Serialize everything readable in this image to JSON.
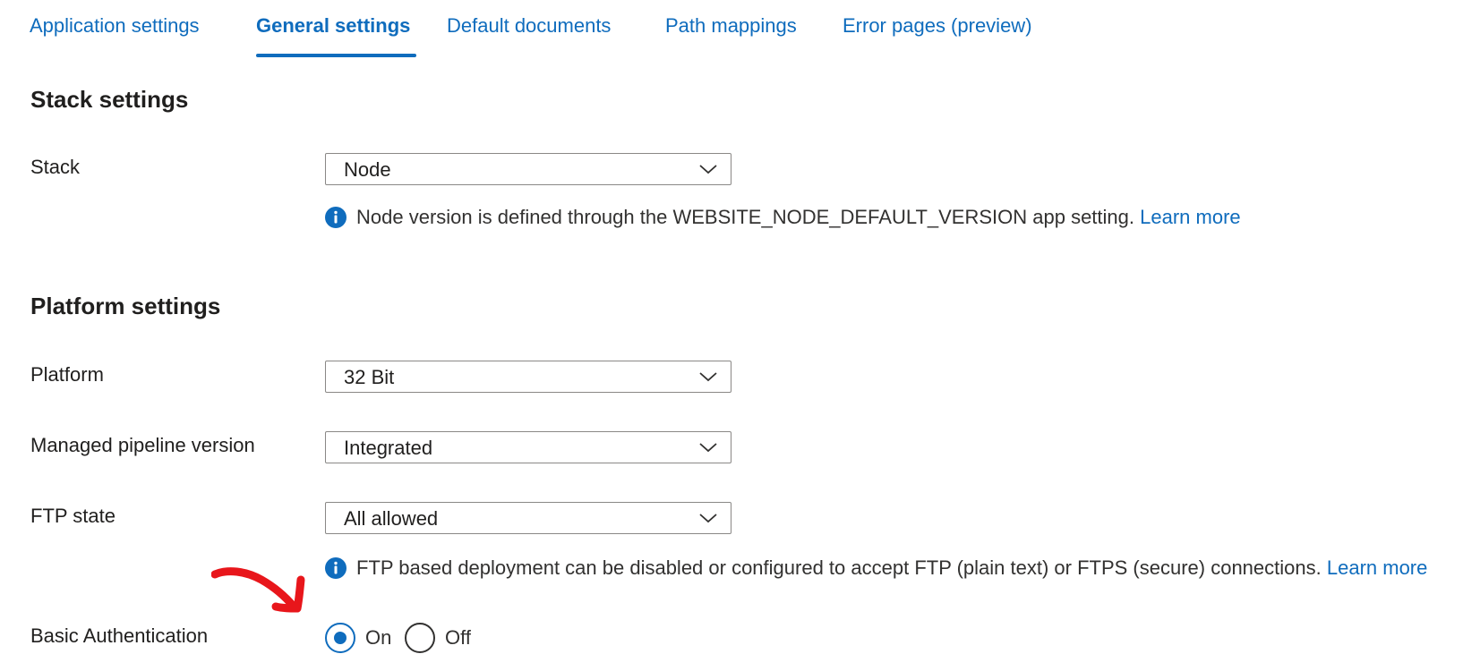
{
  "tabs": [
    {
      "label": "Application settings",
      "active": false
    },
    {
      "label": "General settings",
      "active": true
    },
    {
      "label": "Default documents",
      "active": false
    },
    {
      "label": "Path mappings",
      "active": false
    },
    {
      "label": "Error pages (preview)",
      "active": false
    }
  ],
  "stack_section": {
    "title": "Stack settings",
    "stack": {
      "label": "Stack",
      "value": "Node"
    },
    "info": {
      "text": "Node version is defined through the WEBSITE_NODE_DEFAULT_VERSION app setting.",
      "link": "Learn more"
    }
  },
  "platform_section": {
    "title": "Platform settings",
    "platform": {
      "label": "Platform",
      "value": "32 Bit"
    },
    "pipeline": {
      "label": "Managed pipeline version",
      "value": "Integrated"
    },
    "ftp": {
      "label": "FTP state",
      "value": "All allowed"
    },
    "ftp_info": {
      "text": "FTP based deployment can be disabled or configured to accept FTP (plain text) or FTPS (secure) connections.",
      "link": "Learn more"
    },
    "basic_auth": {
      "label": "Basic Authentication",
      "options": [
        "On",
        "Off"
      ],
      "selected": "On"
    }
  },
  "colors": {
    "accent": "#0f6cbd",
    "text": "#201f1e",
    "annotation": "#e8161b"
  },
  "icons": {
    "chevron": "chevron-down-icon",
    "info": "info-icon",
    "annotation": "red-arrow-annotation"
  }
}
